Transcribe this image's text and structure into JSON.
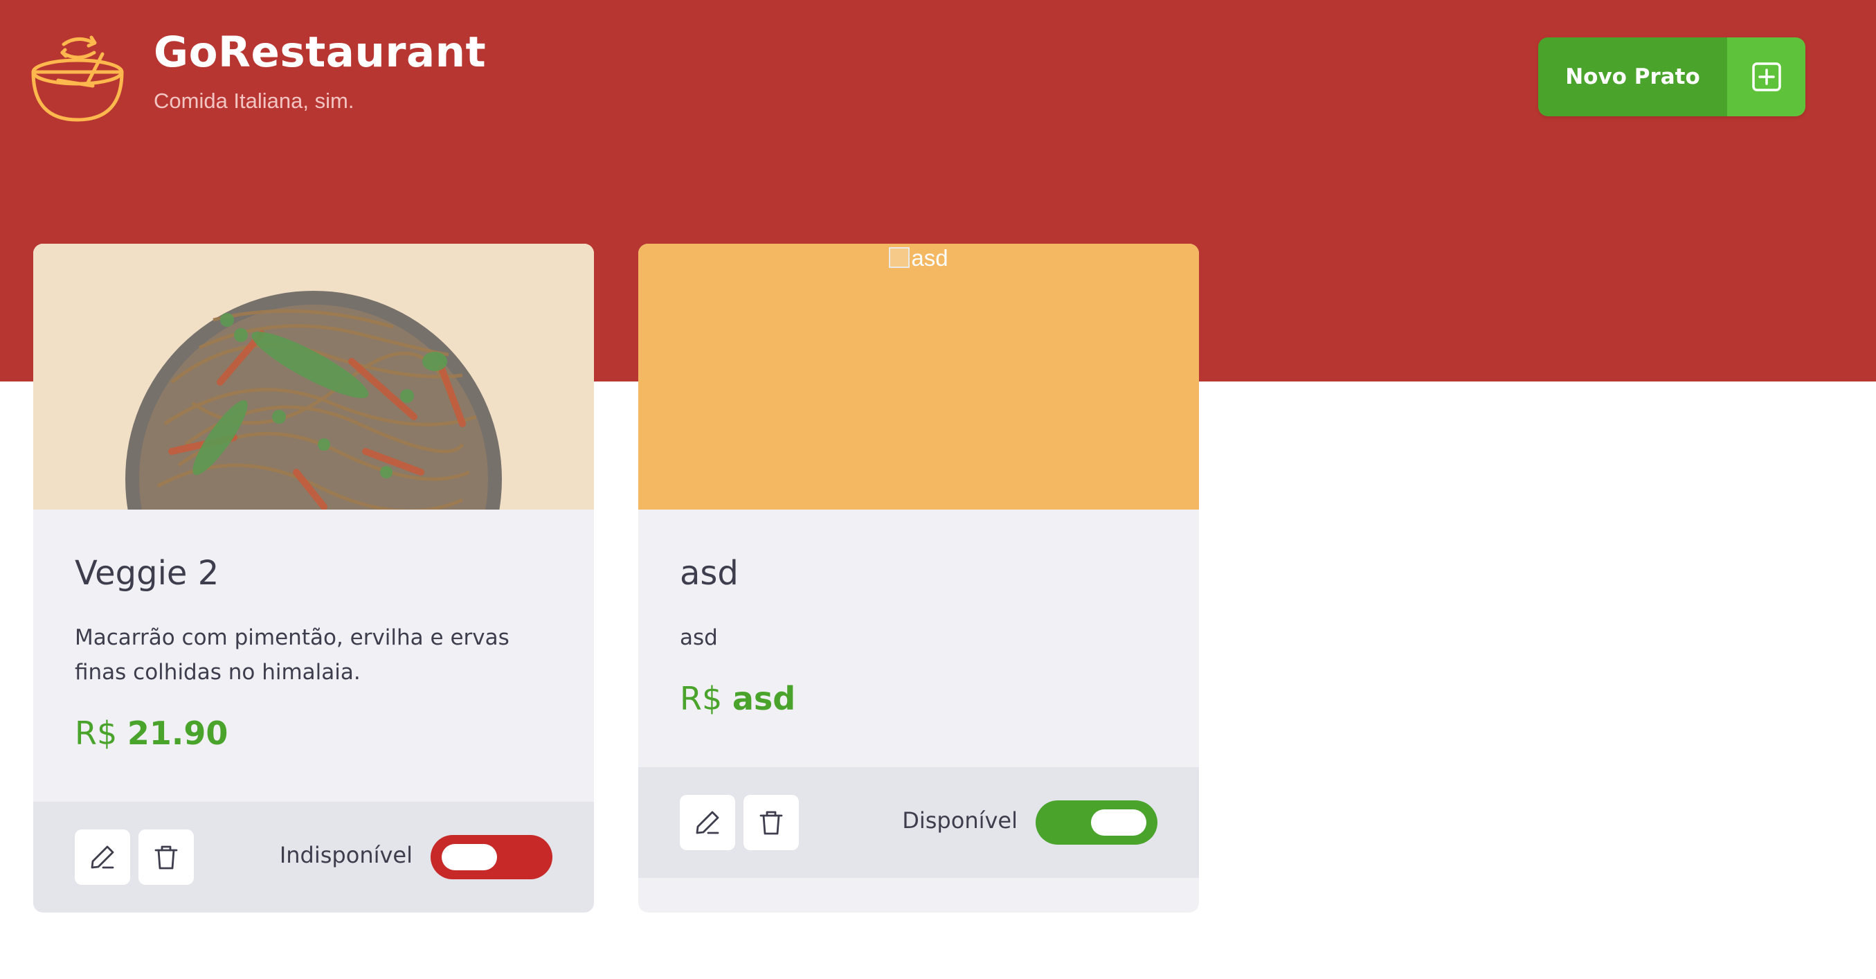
{
  "header": {
    "title": "GoRestaurant",
    "subtitle": "Comida Italiana, sim.",
    "new_button_label": "Novo Prato",
    "logo_icon": "bowl-icon",
    "new_button_icon": "plus-square-icon"
  },
  "colors": {
    "header_bg": "#b83631",
    "primary_green": "#4aa42c",
    "green_light": "#5ec23a",
    "unavailable_red": "#c72828",
    "card_bg": "#f0f0f5",
    "footer_bg": "#e4e4eb",
    "text": "#3d3d4d",
    "logo_yellow": "#ffb84d"
  },
  "foods": [
    {
      "name": "Veggie 2",
      "description": "Macarrão com pimentão, ervilha e ervas finas colhidas no himalaia.",
      "price_currency": "R$",
      "price_value": "21.90",
      "availability_label": "Indisponível",
      "available": false,
      "image": "pasta-bowl-photo"
    },
    {
      "name": "asd",
      "description": "asd",
      "price_currency": "R$",
      "price_value": "asd",
      "availability_label": "Disponível",
      "available": true,
      "image_alt": "asd"
    }
  ]
}
